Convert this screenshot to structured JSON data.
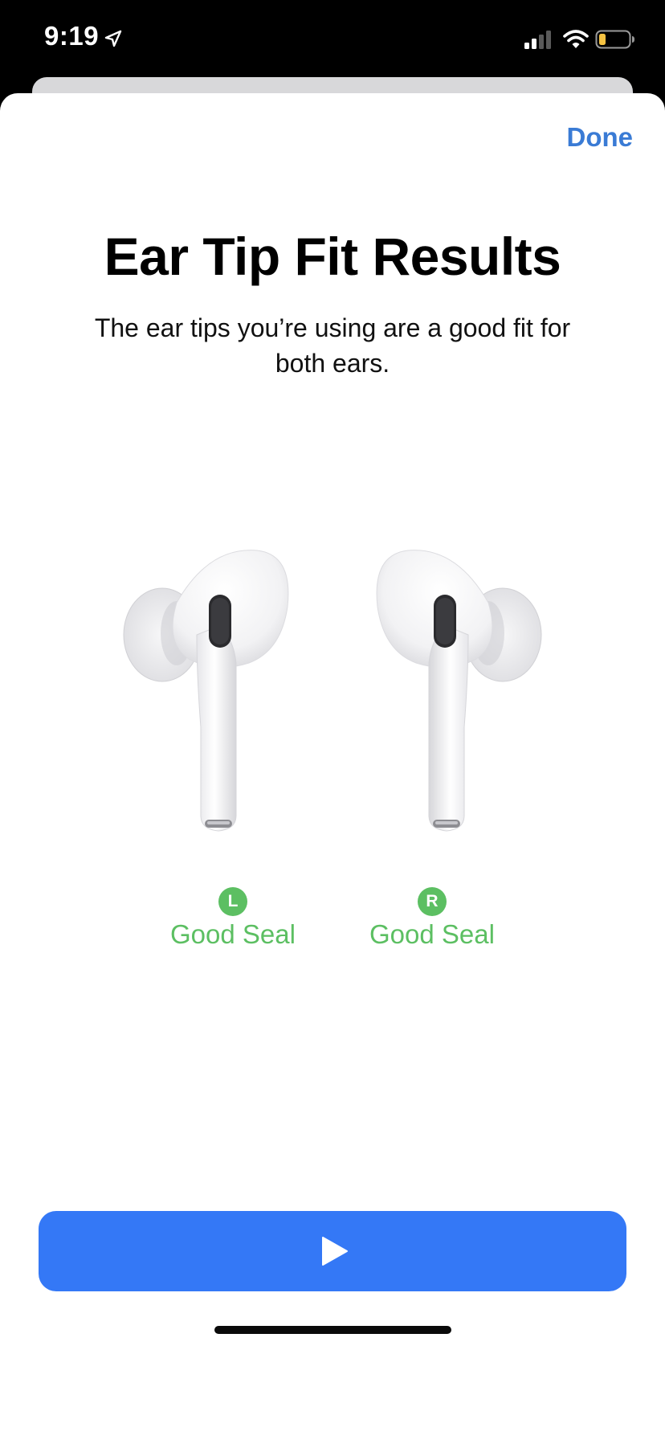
{
  "status_bar": {
    "time": "9:19",
    "icons": [
      "location-arrow-icon",
      "cellular-signal-icon",
      "wifi-icon",
      "battery-icon"
    ],
    "battery_color": "#f5c242"
  },
  "sheet": {
    "done_label": "Done",
    "title": "Ear Tip Fit Results",
    "subtitle": "The ear tips you’re using are a good fit for both ears."
  },
  "earbuds": {
    "left": {
      "badge": "L",
      "status": "Good Seal"
    },
    "right": {
      "badge": "R",
      "status": "Good Seal"
    }
  },
  "play_button": {
    "icon": "play-icon"
  },
  "colors": {
    "accent": "#3478f6",
    "link": "#3a7bd5",
    "good_seal": "#5cbf62"
  }
}
